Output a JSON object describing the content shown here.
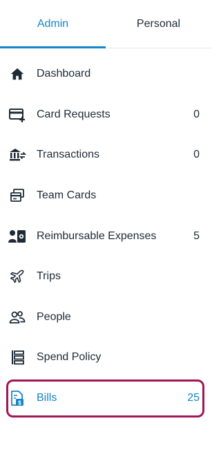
{
  "tabs": [
    {
      "label": "Admin",
      "active": true
    },
    {
      "label": "Personal",
      "active": false
    }
  ],
  "nav": {
    "items": [
      {
        "label": "Dashboard",
        "count": "",
        "icon": "home-icon"
      },
      {
        "label": "Card Requests",
        "count": "0",
        "icon": "card-add-icon"
      },
      {
        "label": "Transactions",
        "count": "0",
        "icon": "bank-transfer-icon"
      },
      {
        "label": "Team Cards",
        "count": "",
        "icon": "cards-stack-icon"
      },
      {
        "label": "Reimbursable Expenses",
        "count": "5",
        "icon": "person-receipt-icon"
      },
      {
        "label": "Trips",
        "count": "",
        "icon": "airplane-icon"
      },
      {
        "label": "People",
        "count": "",
        "icon": "people-icon"
      },
      {
        "label": "Spend Policy",
        "count": "",
        "icon": "policy-list-icon"
      },
      {
        "label": "Bills",
        "count": "25",
        "icon": "bill-dollar-icon",
        "active": true
      }
    ]
  },
  "colors": {
    "accent": "#1485c6",
    "highlight": "#a01656",
    "text": "#1f2a37"
  }
}
